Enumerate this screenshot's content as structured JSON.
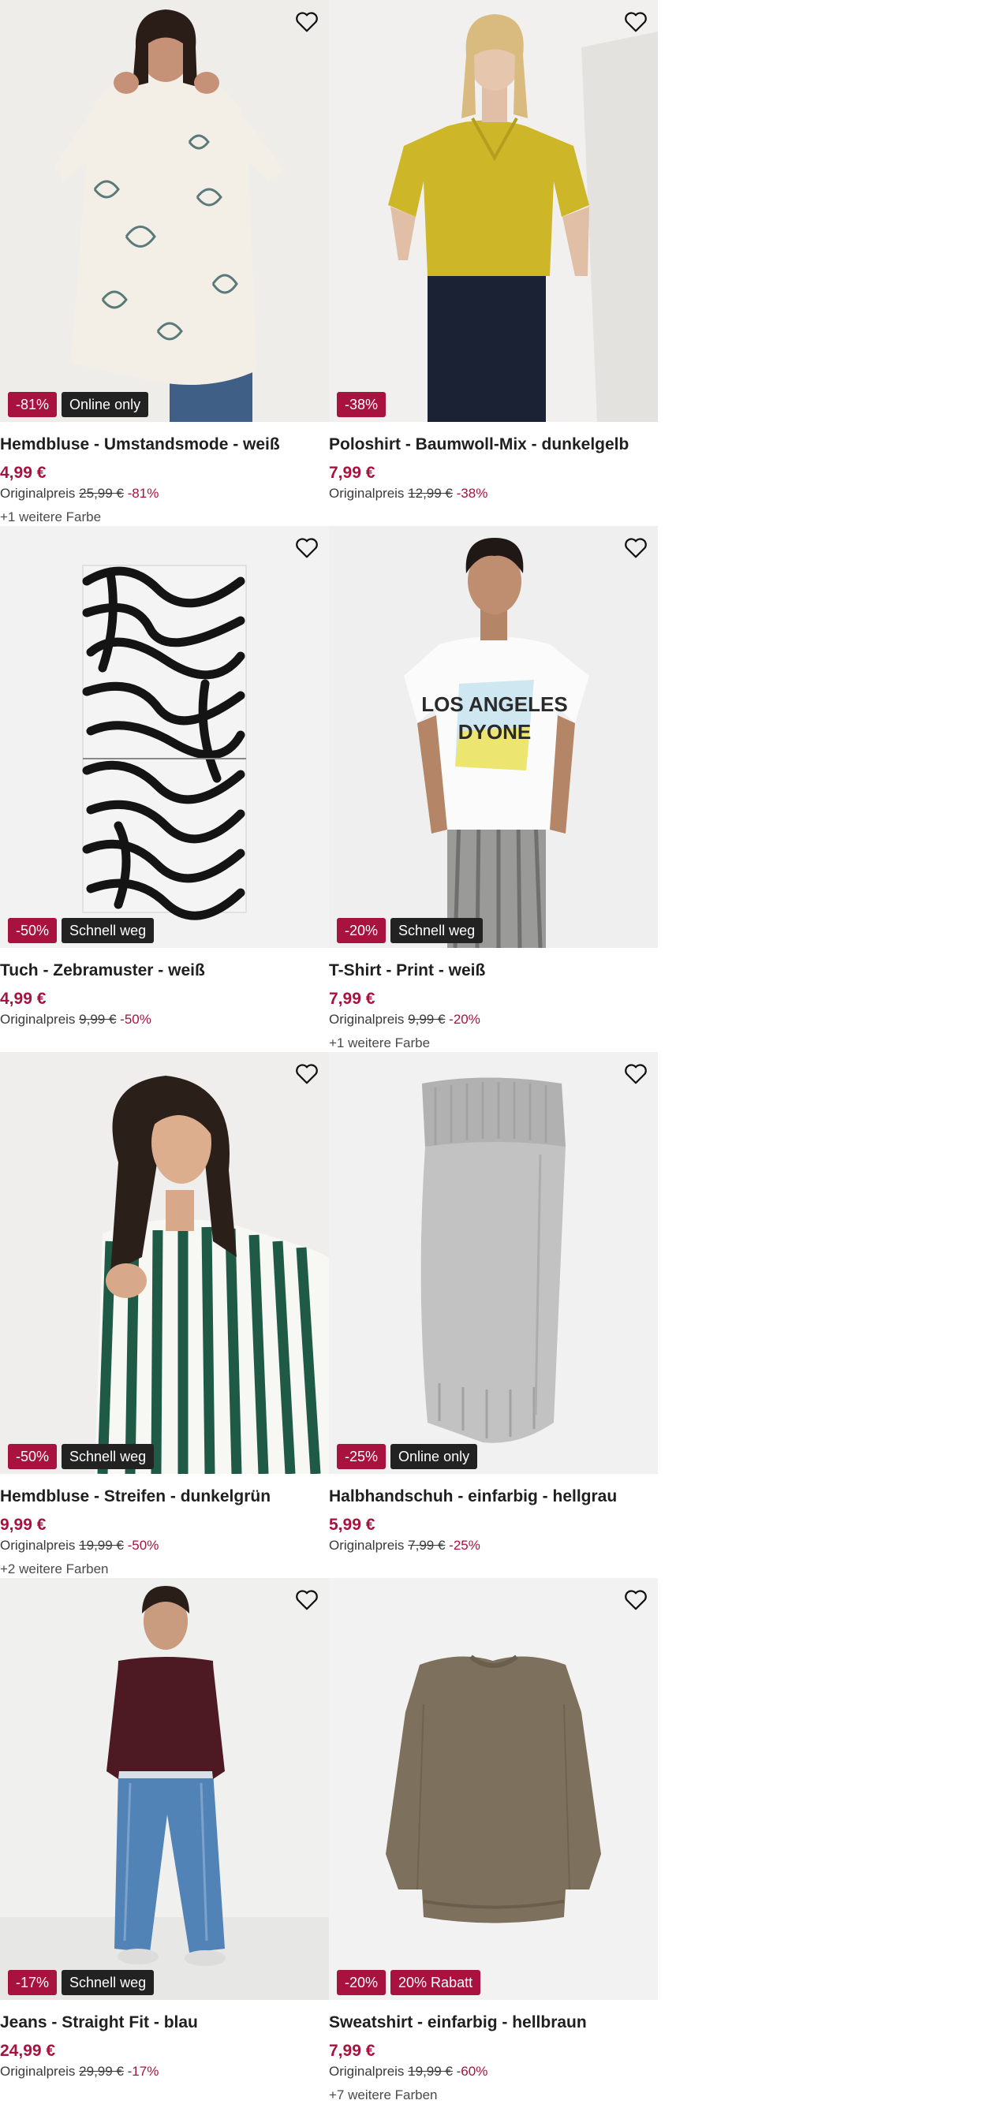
{
  "colors": {
    "price": "#a8123e",
    "badge_discount": "#a8123e",
    "badge_dark": "#222222",
    "image_bg": "#f1f1f1"
  },
  "products": [
    {
      "title": "Hemdbluse - Umstandsmode - weiß",
      "price": "4,99 €",
      "orig_label": "Originalpreis",
      "orig_price": "25,99 €",
      "orig_discount": "-81%",
      "badges": [
        {
          "text": "-81%",
          "kind": "discount"
        },
        {
          "text": "Online only",
          "kind": "dark"
        }
      ],
      "more_colors": "+1 weitere Farbe",
      "image": "woman-floral-blouse"
    },
    {
      "title": "Poloshirt - Baumwoll-Mix - dunkelgelb",
      "price": "7,99 €",
      "orig_label": "Originalpreis",
      "orig_price": "12,99 €",
      "orig_discount": "-38%",
      "badges": [
        {
          "text": "-38%",
          "kind": "discount"
        }
      ],
      "more_colors": "",
      "image": "woman-yellow-polo"
    },
    {
      "title": "Tuch - Zebramuster - weiß",
      "price": "4,99 €",
      "orig_label": "Originalpreis",
      "orig_price": "9,99 €",
      "orig_discount": "-50%",
      "badges": [
        {
          "text": "-50%",
          "kind": "discount"
        },
        {
          "text": "Schnell weg",
          "kind": "dark"
        }
      ],
      "more_colors": "",
      "image": "zebra-scarf"
    },
    {
      "title": "T-Shirt - Print - weiß",
      "price": "7,99 €",
      "orig_label": "Originalpreis",
      "orig_price": "9,99 €",
      "orig_discount": "-20%",
      "badges": [
        {
          "text": "-20%",
          "kind": "discount"
        },
        {
          "text": "Schnell weg",
          "kind": "dark"
        }
      ],
      "more_colors": "+1 weitere Farbe",
      "image": "man-print-tshirt"
    },
    {
      "title": "Hemdbluse - Streifen - dunkelgrün",
      "price": "9,99 €",
      "orig_label": "Originalpreis",
      "orig_price": "19,99 €",
      "orig_discount": "-50%",
      "badges": [
        {
          "text": "-50%",
          "kind": "discount"
        },
        {
          "text": "Schnell weg",
          "kind": "dark"
        }
      ],
      "more_colors": "+2 weitere Farben",
      "image": "woman-striped-blouse"
    },
    {
      "title": "Halbhandschuh - einfarbig - hellgrau",
      "price": "5,99 €",
      "orig_label": "Originalpreis",
      "orig_price": "7,99 €",
      "orig_discount": "-25%",
      "badges": [
        {
          "text": "-25%",
          "kind": "discount"
        },
        {
          "text": "Online only",
          "kind": "dark"
        }
      ],
      "more_colors": "",
      "image": "grey-knit-warmer"
    },
    {
      "title": "Jeans - Straight Fit - blau",
      "price": "24,99 €",
      "orig_label": "Originalpreis",
      "orig_price": "29,99 €",
      "orig_discount": "-17%",
      "badges": [
        {
          "text": "-17%",
          "kind": "discount"
        },
        {
          "text": "Schnell weg",
          "kind": "dark"
        }
      ],
      "more_colors": "",
      "image": "woman-blue-jeans"
    },
    {
      "title": "Sweatshirt - einfarbig - hellbraun",
      "price": "7,99 €",
      "orig_label": "Originalpreis",
      "orig_price": "19,99 €",
      "orig_discount": "-60%",
      "badges": [
        {
          "text": "-20%",
          "kind": "discount"
        },
        {
          "text": "20% Rabatt",
          "kind": "rabatt"
        }
      ],
      "more_colors": "+7 weitere Farben",
      "image": "brown-sweatshirt"
    }
  ]
}
